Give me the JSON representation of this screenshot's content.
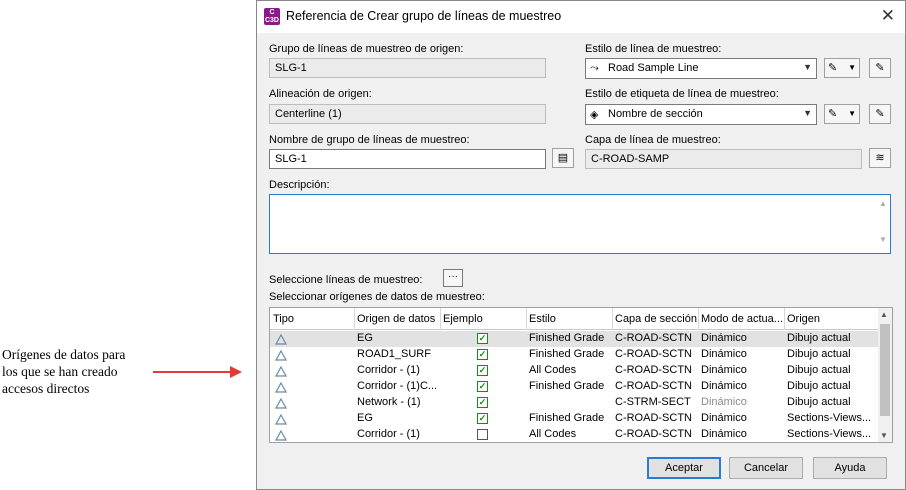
{
  "callout": {
    "line1": "Orígenes de datos para",
    "line2": "los que se han creado",
    "line3": "accesos directos"
  },
  "dialog": {
    "app_icon": "C3D",
    "title": "Referencia de Crear grupo de líneas de muestreo",
    "source_group_label": "Grupo de líneas de muestreo de origen:",
    "source_group_value": "SLG-1",
    "alignment_label": "Alineación de origen:",
    "alignment_value": "Centerline (1)",
    "group_name_label": "Nombre de grupo de líneas de muestreo:",
    "group_name_value": "SLG-1",
    "style_label": "Estilo de línea de muestreo:",
    "style_value": "Road Sample Line",
    "label_style_label": "Estilo de etiqueta de línea de muestreo:",
    "label_style_value": "Nombre de sección",
    "layer_label": "Capa de línea de muestreo:",
    "layer_value": "C-ROAD-SAMP",
    "description_label": "Descripción:",
    "description_value": "",
    "select_lines_label": "Seleccione líneas de muestreo:",
    "select_lines_button": "···",
    "select_sources_label": "Seleccionar orígenes de datos de muestreo:",
    "columns": [
      "Tipo",
      "Origen de datos",
      "Ejemplo",
      "Estilo",
      "Capa de sección",
      "Modo de actua...",
      "Origen"
    ],
    "rows": [
      {
        "source": "EG",
        "sample": true,
        "style": "Finished Grade",
        "layer": "C-ROAD-SCTN",
        "mode": "Dinámico",
        "origin": "Dibujo actual",
        "mode_dim": false,
        "selected": true
      },
      {
        "source": "ROAD1_SURF",
        "sample": true,
        "style": "Finished Grade",
        "layer": "C-ROAD-SCTN",
        "mode": "Dinámico",
        "origin": "Dibujo actual",
        "mode_dim": false,
        "selected": false
      },
      {
        "source": "Corridor - (1)",
        "sample": true,
        "style": "All Codes",
        "layer": "C-ROAD-SCTN",
        "mode": "Dinámico",
        "origin": "Dibujo actual",
        "mode_dim": false,
        "selected": false
      },
      {
        "source": "Corridor - (1)C...",
        "sample": true,
        "style": "Finished Grade",
        "layer": "C-ROAD-SCTN",
        "mode": "Dinámico",
        "origin": "Dibujo actual",
        "mode_dim": false,
        "selected": false
      },
      {
        "source": "Network - (1)",
        "sample": true,
        "style": "",
        "layer": "C-STRM-SECT",
        "mode": "Dinámico",
        "origin": "Dibujo actual",
        "mode_dim": true,
        "selected": false
      },
      {
        "source": "EG",
        "sample": true,
        "style": "Finished Grade",
        "layer": "C-ROAD-SCTN",
        "mode": "Dinámico",
        "origin": "Sections-Views...",
        "mode_dim": false,
        "selected": false
      },
      {
        "source": "Corridor - (1)",
        "sample": false,
        "style": "All Codes",
        "layer": "C-ROAD-SCTN",
        "mode": "Dinámico",
        "origin": "Sections-Views...",
        "mode_dim": false,
        "selected": false
      }
    ],
    "ok_button": "Aceptar",
    "cancel_button": "Cancelar",
    "help_button": "Ayuda"
  },
  "colors": {
    "accent": "#2a7bd4",
    "arrow": "#e53935",
    "check": "#1a8a1a"
  }
}
